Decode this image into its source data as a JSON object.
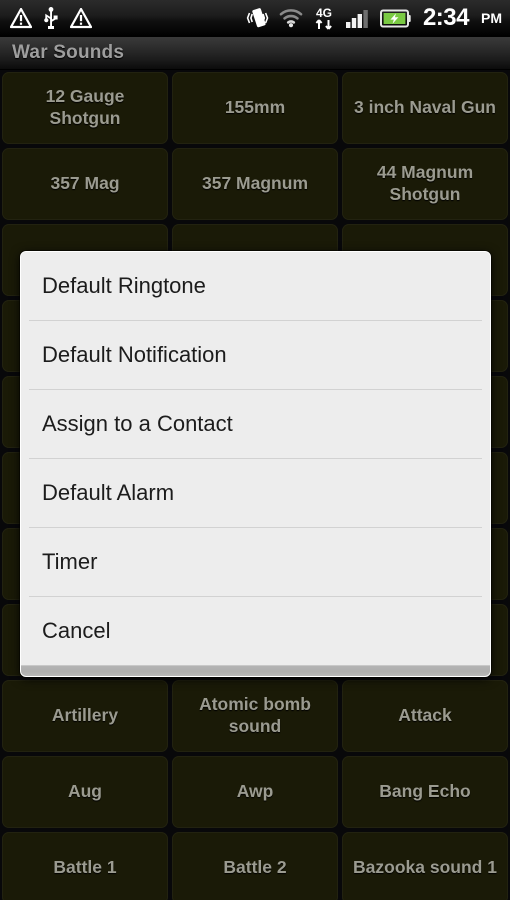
{
  "status_bar": {
    "left_icons": [
      "warning-triangle-icon",
      "usb-icon",
      "warning-triangle-icon"
    ],
    "right_icons": [
      "vibrate-icon",
      "wifi-icon",
      "4g-data-icon",
      "signal-bars-icon",
      "battery-charging-icon"
    ],
    "network_label": "4G",
    "time": "2:34",
    "meridiem": "PM",
    "signal_bars_filled": 3,
    "signal_bars_total": 4
  },
  "title_bar": {
    "title": "War Sounds"
  },
  "grid": {
    "rows": [
      [
        "12 Gauge Shotgun",
        "155mm",
        "3 inch Naval Gun"
      ],
      [
        "357 Mag",
        "357 Magnum",
        "44 Magnum Shotgun"
      ],
      [
        "",
        "",
        ""
      ],
      [
        "",
        "",
        ""
      ],
      [
        "",
        "",
        ""
      ],
      [
        "",
        "",
        ""
      ],
      [
        "",
        "",
        ""
      ],
      [
        "",
        "",
        ""
      ],
      [
        "Artillery",
        "Atomic bomb sound",
        "Attack"
      ],
      [
        "Aug",
        "Awp",
        "Bang Echo"
      ],
      [
        "Battle 1",
        "Battle 2",
        "Bazooka sound 1"
      ]
    ]
  },
  "dialog": {
    "items": [
      "Default Ringtone",
      "Default Notification",
      "Assign to a Contact",
      "Default Alarm",
      "Timer",
      "Cancel"
    ]
  },
  "colors": {
    "button_bg": "#1a1a07",
    "button_text": "#9b9b90",
    "dialog_bg": "#ededed",
    "dialog_text": "#1c1c1c",
    "dialog_footer": "#b4b4b4",
    "title_text": "#9e9e9e",
    "battery_green": "#7ac943"
  }
}
